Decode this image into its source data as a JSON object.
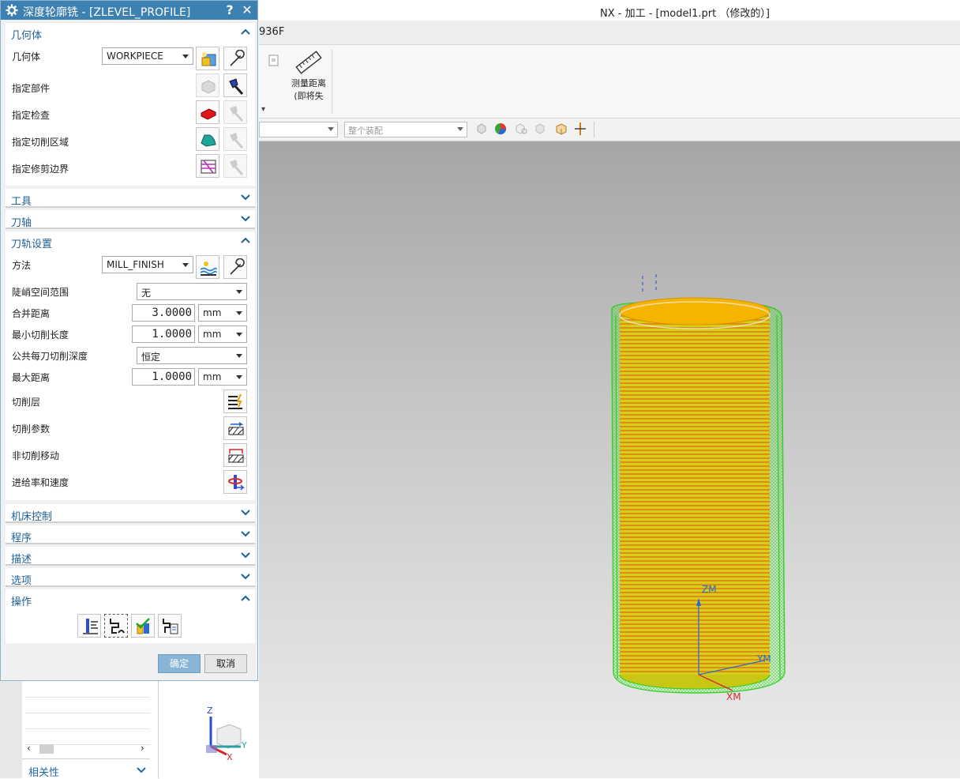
{
  "app": {
    "title": "NX - 加工 - [model1.prt （修改的）]",
    "tab_fragment": "936F",
    "ribbon": {
      "measure_label": "测量距离\n(即将失"
    },
    "selection_bar": {
      "assembly_placeholder": "整个装配"
    }
  },
  "dialog": {
    "title": "深度轮廓铣 - [ZLEVEL_PROFILE]",
    "help": "?",
    "close": "✕",
    "geometry": {
      "header": "几何体",
      "geometry_label": "几何体",
      "geometry_value": "WORKPIECE",
      "specify_part": "指定部件",
      "specify_check": "指定检查",
      "specify_cut_area": "指定切削区域",
      "specify_trim_boundary": "指定修剪边界"
    },
    "tool": {
      "header": "工具"
    },
    "axis": {
      "header": "刀轴"
    },
    "path": {
      "header": "刀轨设置",
      "method_label": "方法",
      "method_value": "MILL_FINISH",
      "steep_label": "陡峭空间范围",
      "steep_value": "无",
      "merge_label": "合并距离",
      "merge_value": "3.0000",
      "merge_unit": "mm",
      "min_cut_label": "最小切削长度",
      "min_cut_value": "1.0000",
      "min_cut_unit": "mm",
      "depth_label": "公共每刀切削深度",
      "depth_value": "恒定",
      "max_dist_label": "最大距离",
      "max_dist_value": "1.0000",
      "max_dist_unit": "mm",
      "cut_levels": "切削层",
      "cut_params": "切削参数",
      "non_cut_moves": "非切削移动",
      "feeds_speeds": "进给率和速度"
    },
    "machine": {
      "header": "机床控制"
    },
    "program": {
      "header": "程序"
    },
    "description": {
      "header": "描述"
    },
    "options": {
      "header": "选项"
    },
    "actions": {
      "header": "操作"
    },
    "ok": "确定",
    "cancel": "取消"
  },
  "nav": {
    "related": "相关性"
  },
  "viewport": {
    "zm": "ZM",
    "ym": "YM",
    "xm": "XM",
    "z": "Z",
    "y": "Y",
    "x": "X"
  },
  "colors": {
    "title_bar": "#3d80b2",
    "section_text": "#1e5f94",
    "ok_button": "#8ab4d4",
    "toolpath": "#34d11f",
    "part_top": "#f5b400",
    "part_side": "#c8d014"
  }
}
